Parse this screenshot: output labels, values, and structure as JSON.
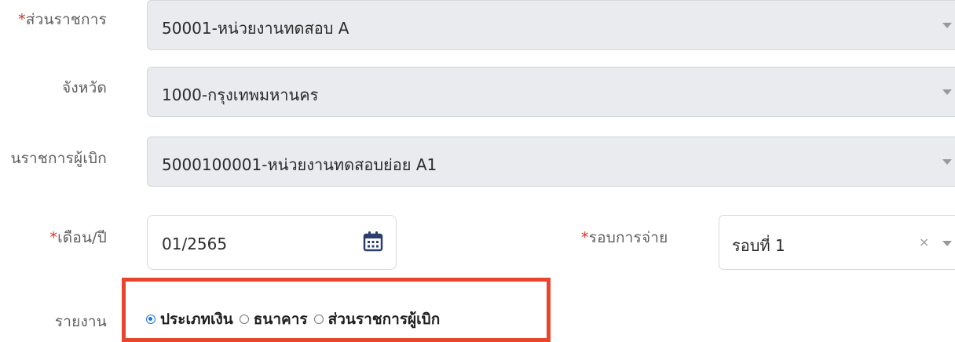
{
  "form": {
    "agency": {
      "label_required_mark": "*",
      "label": "ส่วนราชการ",
      "value": "50001-หน่วยงานทดสอบ A"
    },
    "province": {
      "label": "จังหวัด",
      "value": "1000-กรุงเทพมหานคร"
    },
    "issuing_unit": {
      "label": "นราชการผู้เบิก",
      "value": "5000100001-หน่วยงานทดสอบย่อย A1"
    },
    "month_year": {
      "label_required_mark": "*",
      "label": "เดือน/ปี",
      "value": "01/2565"
    },
    "payment_round": {
      "label_required_mark": "*",
      "label": "รอบการจ่าย",
      "value": "รอบที่ 1",
      "clear_symbol": "×"
    },
    "report": {
      "label": "รายงาน",
      "options": [
        {
          "label": "ประเภทเงิน",
          "selected": true
        },
        {
          "label": "ธนาคาร",
          "selected": false
        },
        {
          "label": "ส่วนราชการผู้เบิก",
          "selected": false
        }
      ]
    }
  },
  "colors": {
    "accent": "#1a73e8",
    "highlight": "#e8452e",
    "required": "#d93025"
  }
}
